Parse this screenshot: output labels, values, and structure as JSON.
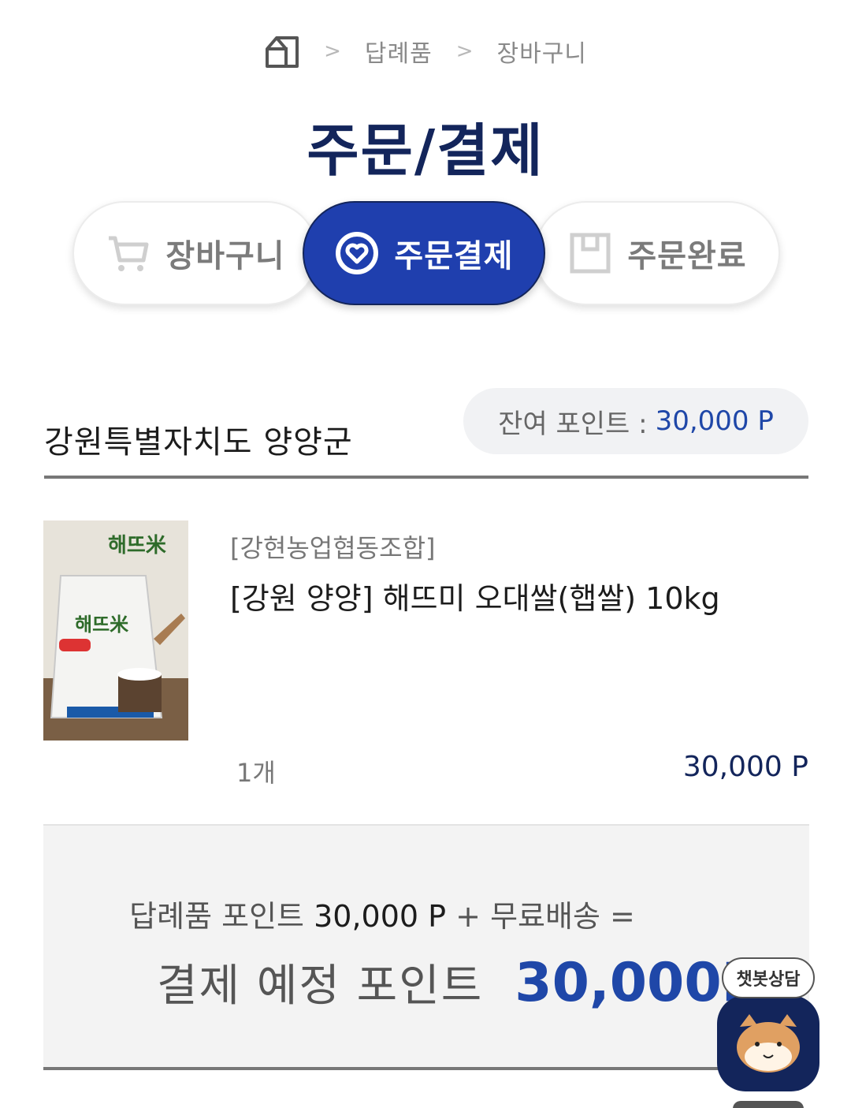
{
  "breadcrumb": {
    "home_icon": "home-icon",
    "items": [
      "답례품",
      "장바구니"
    ]
  },
  "page_title": "주문/결제",
  "steps": {
    "cart": {
      "label": "장바구니",
      "icon": "cart-icon"
    },
    "payment": {
      "label": "주문결제",
      "icon": "heart-circle-icon",
      "active": true
    },
    "done": {
      "label": "주문완료",
      "icon": "box-icon"
    }
  },
  "region": "강원특별자치도 양양군",
  "points": {
    "label": "잔여 포인트 :",
    "value": "30,000 P"
  },
  "product": {
    "vendor": "[강현농업협동조합]",
    "name": "[강원 양양] 해뜨미 오대쌀(햅쌀) 10kg",
    "quantity": "1개",
    "price": "30,000 P"
  },
  "summary": {
    "line_prefix": "답례품 포인트",
    "line_points": "30,000 P",
    "line_suffix": "+ 무료배송 =",
    "pay_label": "결제 예정 포인트",
    "pay_value": "30,000P"
  },
  "chatbot": {
    "label": "챗봇상담"
  },
  "colors": {
    "navy": "#13255b",
    "accent_blue": "#1f3fae",
    "point_blue": "#1f47a8"
  }
}
